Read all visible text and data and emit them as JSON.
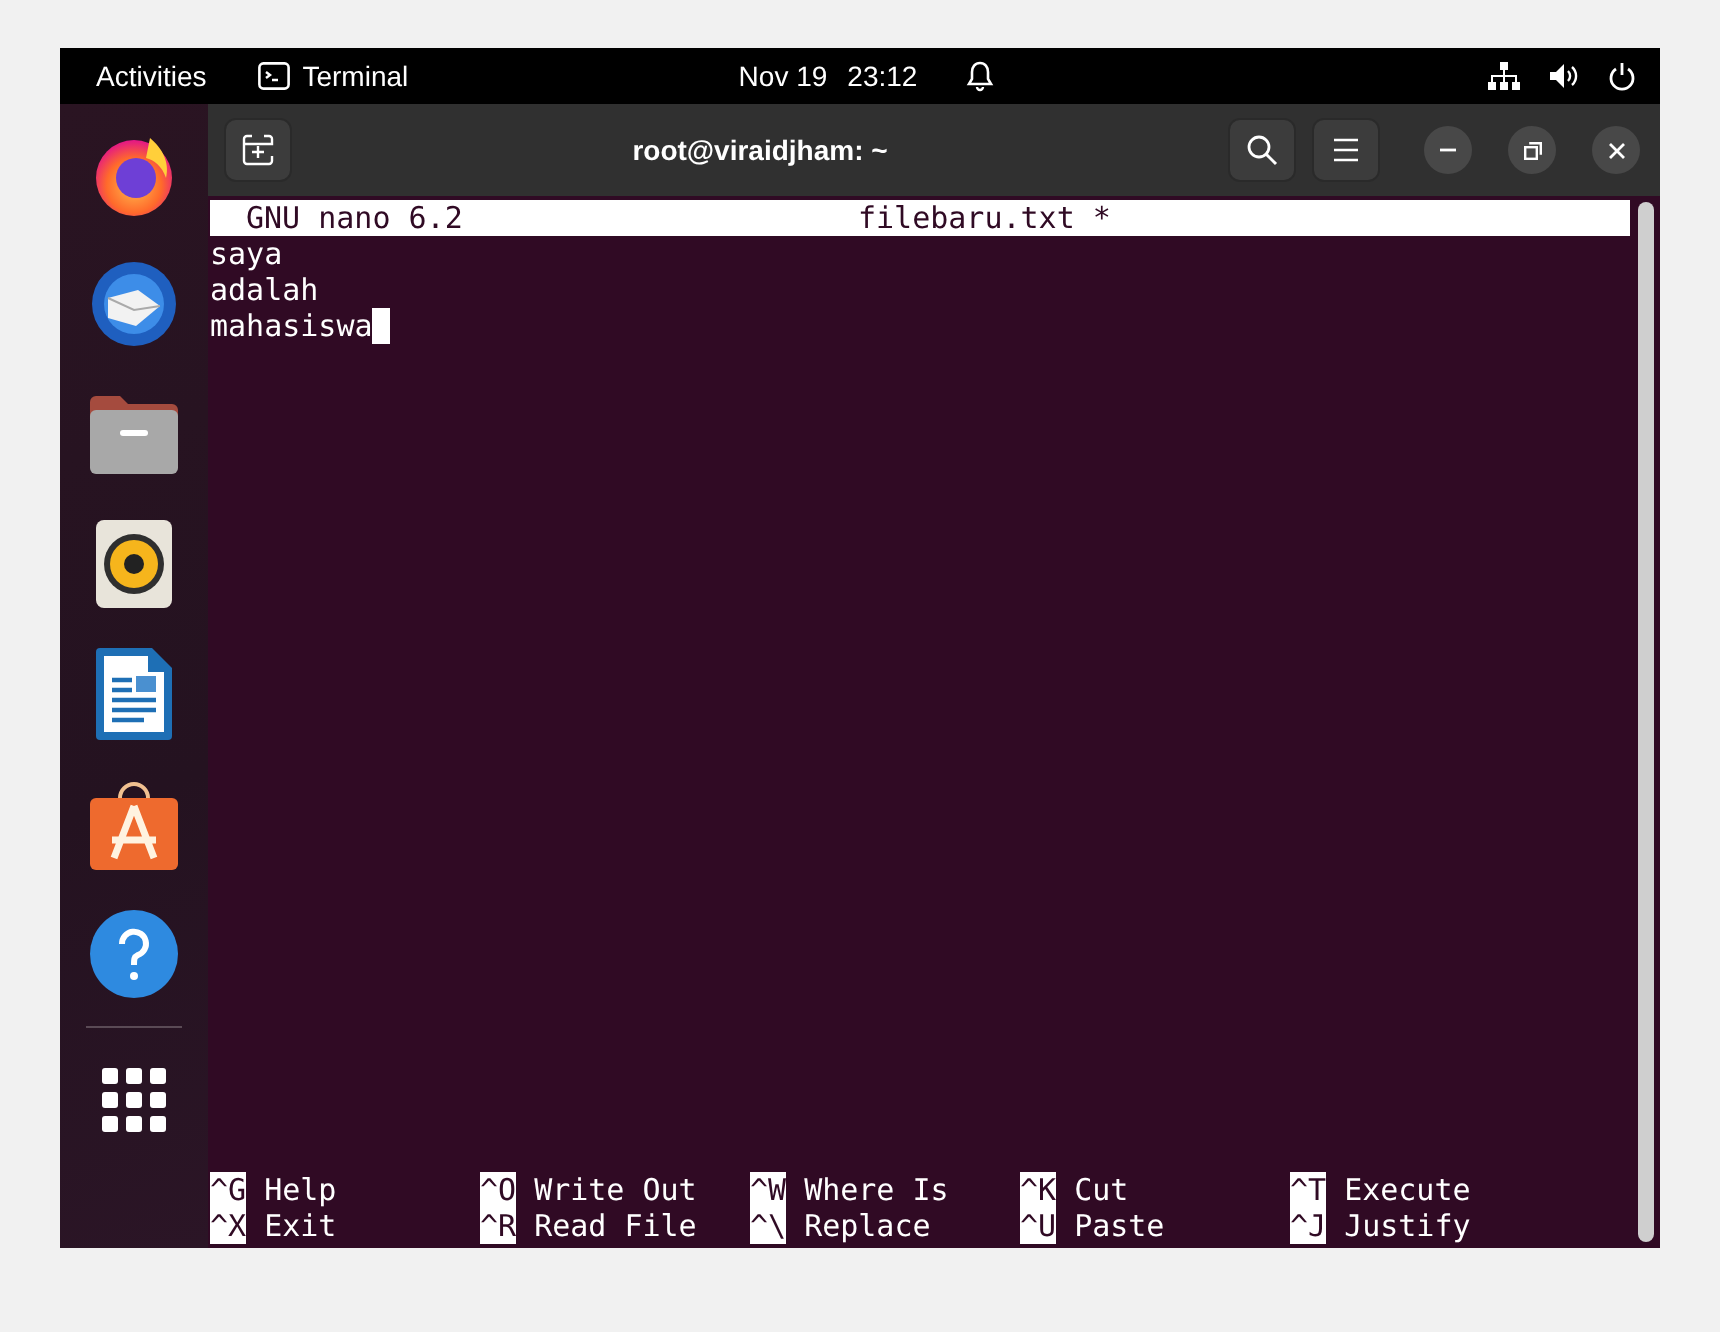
{
  "top_bar": {
    "activities": "Activities",
    "app": "Terminal",
    "date": "Nov 19",
    "time": "23:12"
  },
  "terminal": {
    "title": "root@viraidjham: ~"
  },
  "nano": {
    "app": "GNU nano 6.2",
    "filename": "filebaru.txt *",
    "lines": [
      "saya",
      "adalah",
      "mahasiswa"
    ],
    "shortcut_rows": [
      [
        {
          "key": "^G",
          "label": "Help"
        },
        {
          "key": "^O",
          "label": "Write Out"
        },
        {
          "key": "^W",
          "label": "Where Is"
        },
        {
          "key": "^K",
          "label": "Cut"
        },
        {
          "key": "^T",
          "label": "Execute"
        }
      ],
      [
        {
          "key": "^X",
          "label": "Exit"
        },
        {
          "key": "^R",
          "label": "Read File"
        },
        {
          "key": "^\\",
          "label": "Replace"
        },
        {
          "key": "^U",
          "label": "Paste"
        },
        {
          "key": "^J",
          "label": "Justify"
        }
      ]
    ]
  }
}
